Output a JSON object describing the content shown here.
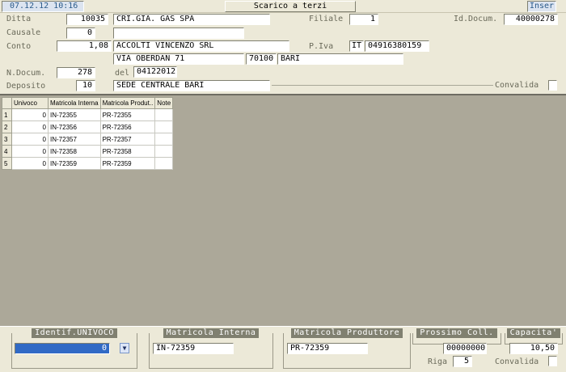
{
  "header": {
    "datetime": "07.12.12 10:16",
    "title": "Scarico a terzi",
    "mode": "Inser",
    "ditta_label": "Ditta",
    "ditta_code": "10035",
    "ditta_name": "CRI.GIA. GAS SPA",
    "filiale_label": "Filiale",
    "filiale_value": "1",
    "id_docum_label": "Id.Docum.",
    "id_docum_value": "40000278",
    "causale_label": "Causale",
    "causale_code": "0",
    "causale_desc": "",
    "conto_label": "Conto",
    "conto_code": "1,08",
    "conto_name": "ACCOLTI VINCENZO SRL",
    "piva_label": "P.Iva",
    "piva_country": "IT",
    "piva_value": "04916380159",
    "address_street": "VIA OBERDAN 71",
    "address_cap": "70100",
    "address_city": "BARI",
    "ndocum_label": "N.Docum.",
    "ndocum_value": "278",
    "del_label": "del",
    "del_value": "04122012",
    "deposito_label": "Deposito",
    "deposito_code": "10",
    "deposito_name": "SEDE CENTRALE BARI",
    "convalida_label": "Convalida"
  },
  "grid": {
    "columns": [
      "Univoco",
      "Matricola Interna",
      "Matricola Produt..",
      "Note"
    ],
    "rows": [
      {
        "n": "1",
        "univoco": "0",
        "interna": "IN-72355",
        "produttore": "PR-72355",
        "note": ""
      },
      {
        "n": "2",
        "univoco": "0",
        "interna": "IN-72356",
        "produttore": "PR-72356",
        "note": ""
      },
      {
        "n": "3",
        "univoco": "0",
        "interna": "IN-72357",
        "produttore": "PR-72357",
        "note": ""
      },
      {
        "n": "4",
        "univoco": "0",
        "interna": "IN-72358",
        "produttore": "PR-72358",
        "note": ""
      },
      {
        "n": "5",
        "univoco": "0",
        "interna": "IN-72359",
        "produttore": "PR-72359",
        "note": ""
      }
    ]
  },
  "footer": {
    "identif_title": "Identif.UNIVOCO",
    "identif_value": "0",
    "matricola_interna_title": "Matricola Interna",
    "matricola_interna_value": "IN-72359",
    "matricola_produttore_title": "Matricola Produttore",
    "matricola_produttore_value": "PR-72359",
    "prossimo_title": "Prossimo Coll.",
    "prossimo_value": "00000000",
    "capacita_title": "Capacita'",
    "capacita_value": "10,50",
    "riga_label": "Riga",
    "riga_value": "5",
    "convalida_label": "Convalida"
  },
  "colors": {
    "window_bg": "#ece9d8",
    "grid_bg": "#aca899",
    "label": "#6a6a5a",
    "selection": "#316ac5",
    "datetime_bg": "#dce4f0"
  }
}
